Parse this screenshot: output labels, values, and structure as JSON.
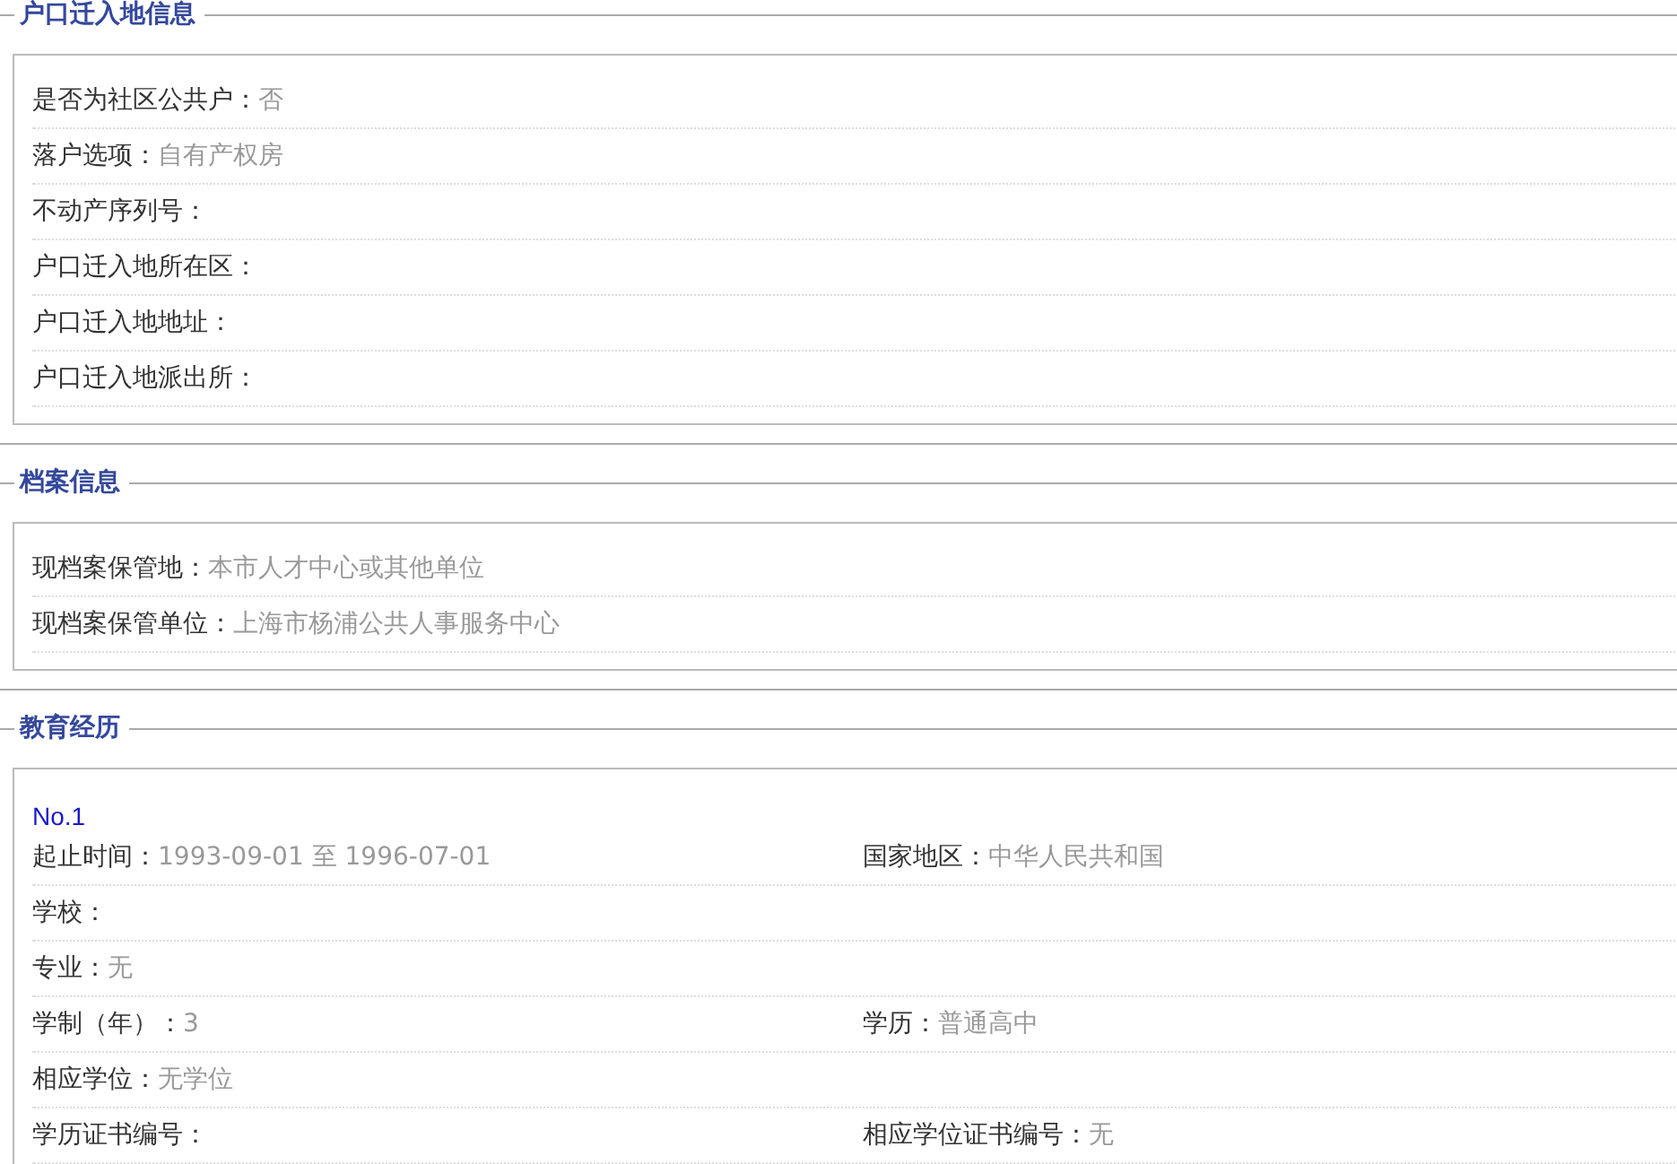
{
  "sections": [
    {
      "title": "户口迁入地信息",
      "fields": [
        {
          "label": "是否为社区公共户：",
          "value": "否"
        },
        {
          "label": "落户选项：",
          "value": "自有产权房"
        },
        {
          "label": "不动产序列号："
        },
        {
          "label": "户口迁入地所在区："
        },
        {
          "label": "户口迁入地地址："
        },
        {
          "label": "户口迁入地派出所："
        }
      ]
    },
    {
      "title": "档案信息",
      "fields": [
        {
          "label": "现档案保管地：",
          "value": "本市人才中心或其他单位"
        },
        {
          "label": "现档案保管单位：",
          "value": "上海市杨浦公共人事服务中心"
        }
      ]
    },
    {
      "title": "教育经历",
      "records": [
        {
          "number": "No.1",
          "rows": [
            [
              {
                "label": "起止时间：",
                "value": "1993-09-01 至 1996-07-01"
              },
              {
                "label": "国家地区：",
                "value": "中华人民共和国"
              }
            ],
            [
              {
                "label": "学校："
              }
            ],
            [
              {
                "label": "专业：",
                "value": "无"
              }
            ],
            [
              {
                "label": "学制（年）：",
                "value": "3"
              },
              {
                "label": "学历：",
                "value": "普通高中"
              }
            ],
            [
              {
                "label": "相应学位：",
                "value": "无学位"
              }
            ],
            [
              {
                "label": "学历证书编号："
              },
              {
                "label": "相应学位证书编号：",
                "value": "无"
              }
            ]
          ]
        }
      ]
    }
  ]
}
